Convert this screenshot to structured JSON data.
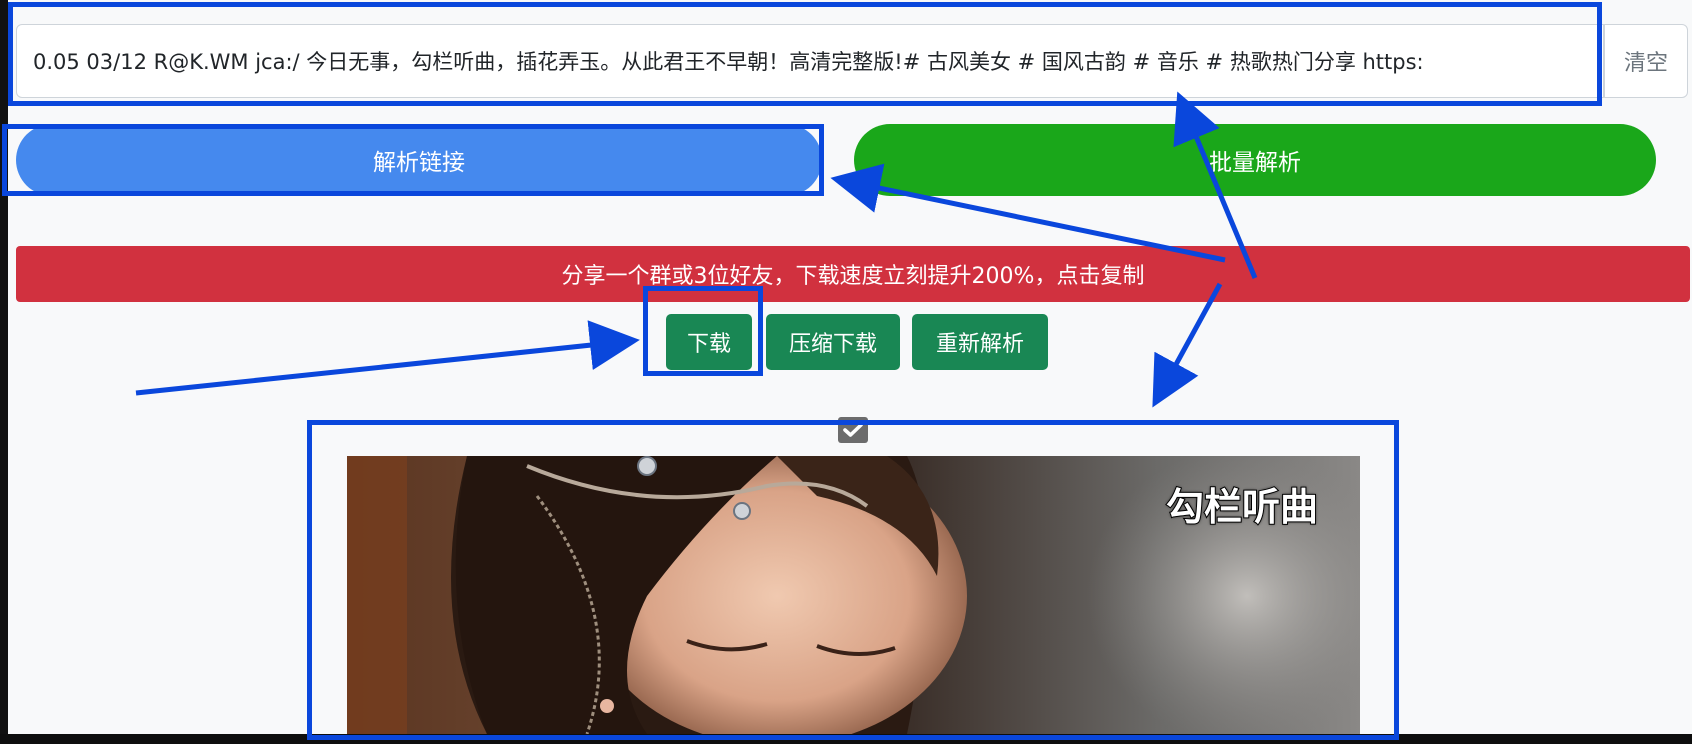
{
  "input": {
    "value": "0.05 03/12 R@K.WM jca:/ 今日无事，勾栏听曲，插花弄玉。从此君王不早朝！高清完整版!# 古风美女 # 国风古韵 # 音乐 # 热歌热门分享  https:",
    "clear_label": "清空"
  },
  "actions": {
    "parse_label": "解析链接",
    "batch_label": "批量解析"
  },
  "share_banner": {
    "text": "分享一个群或3位好友，下载速度立刻提升200%，点击复制"
  },
  "result_buttons": {
    "download_label": "下载",
    "zip_download_label": "压缩下载",
    "reparse_label": "重新解析"
  },
  "video": {
    "caption": "勾栏听曲",
    "checked": true
  },
  "colors": {
    "parse_button": "#4589ee",
    "batch_button": "#1aa71a",
    "share_banner": "#d1313f",
    "result_button": "#198754",
    "annotation": "#0a47dc"
  },
  "icons": {
    "checkbox": "check-icon"
  }
}
